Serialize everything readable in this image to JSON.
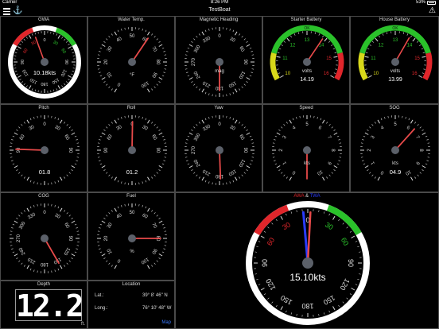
{
  "status": {
    "carrier": "Carrier",
    "time": "8:26 PM",
    "battery": "53%"
  },
  "nav": {
    "title": "TestBoat"
  },
  "gauges": {
    "gwa": {
      "title": "GWA",
      "value": "10.18kts",
      "needle_deg": -20,
      "ticks": [
        "0",
        "30",
        "60",
        "90",
        "120",
        "150",
        "180",
        "150",
        "120",
        "90",
        "60",
        "30"
      ]
    },
    "water_temp": {
      "title": "Water Temp.",
      "unit": "°F",
      "needle_deg": 34,
      "ticks": [
        "0",
        "10",
        "20",
        "30",
        "40",
        "50",
        "60",
        "70",
        "80",
        "90",
        "100"
      ]
    },
    "heading": {
      "title": "Magnetic Heading",
      "unit": "mag",
      "needle_deg": 180,
      "ticks": [
        "0",
        "30",
        "60",
        "90",
        "120",
        "150",
        "180",
        "210",
        "240",
        "270",
        "300",
        "330"
      ]
    },
    "starter": {
      "title": "Starter Battery",
      "value": "14.19",
      "unit": "volts",
      "needle_deg": 34,
      "ticks": [
        "10",
        "11",
        "12",
        "13",
        "14",
        "15",
        "16"
      ],
      "ok_label": "OK"
    },
    "house": {
      "title": "House Battery",
      "value": "13.99",
      "unit": "volts",
      "needle_deg": 30,
      "ticks": [
        "10",
        "11",
        "12",
        "13",
        "14",
        "15",
        "16"
      ],
      "ok_label": "OK"
    },
    "pitch": {
      "title": "Pitch",
      "value": "01.8",
      "needle_deg": -88,
      "ticks": [
        "90",
        "60",
        "30",
        "0",
        "30",
        "60",
        "90"
      ]
    },
    "roll": {
      "title": "Roll",
      "value": "01.2",
      "needle_deg": 1,
      "ticks": [
        "90",
        "60",
        "30",
        "0",
        "30",
        "60",
        "90"
      ]
    },
    "yaw": {
      "title": "Yaw",
      "needle_deg": 178,
      "ticks": [
        "0",
        "30",
        "60",
        "90",
        "120",
        "150",
        "180",
        "210",
        "240",
        "270",
        "300",
        "330"
      ]
    },
    "speed": {
      "title": "Speed",
      "unit": "kts",
      "needle_deg": -180,
      "ticks": [
        "0",
        "1",
        "2",
        "3",
        "4",
        "5",
        "6",
        "7",
        "8",
        "9",
        "10"
      ]
    },
    "sog": {
      "title": "SOG",
      "value": "04.9",
      "unit": "kts",
      "needle_deg": 42,
      "ticks": [
        "0",
        "1",
        "2",
        "3",
        "4",
        "5",
        "6",
        "7",
        "8",
        "9",
        "10"
      ]
    },
    "cog": {
      "title": "COG",
      "needle_deg": 150,
      "ticks": [
        "0",
        "30",
        "60",
        "90",
        "120",
        "150",
        "180",
        "210",
        "240",
        "270",
        "300",
        "330"
      ]
    },
    "fuel": {
      "title": "Fuel",
      "unit": "%",
      "needle_deg": 90,
      "ticks": [
        "0",
        "10",
        "20",
        "30",
        "40",
        "50",
        "60",
        "70",
        "80",
        "90",
        "100"
      ]
    },
    "awa": {
      "title_awa": "AWA",
      "title_amp": "&",
      "title_twa": "TWA",
      "value": "15.10kts",
      "needle_deg": 3,
      "needle2_deg": -5,
      "ticks": [
        "0",
        "30",
        "60",
        "90",
        "120",
        "150",
        "180",
        "150",
        "120",
        "90",
        "60",
        "30"
      ]
    }
  },
  "depth": {
    "title": "Depth",
    "value": "12.2",
    "unit": "ft."
  },
  "location": {
    "title": "Location",
    "lat_label": "Lat.:",
    "lat": "39° 8' 46\" N",
    "long_label": "Long.:",
    "long": "76° 10' 48\" W",
    "map_link": "Map"
  },
  "colors": {
    "red": "#e0262b",
    "green": "#2ac12a",
    "yellow": "#d8d81a",
    "needle": "#e84a4a",
    "hub": "#5b6069",
    "blue": "#2a3cff"
  }
}
